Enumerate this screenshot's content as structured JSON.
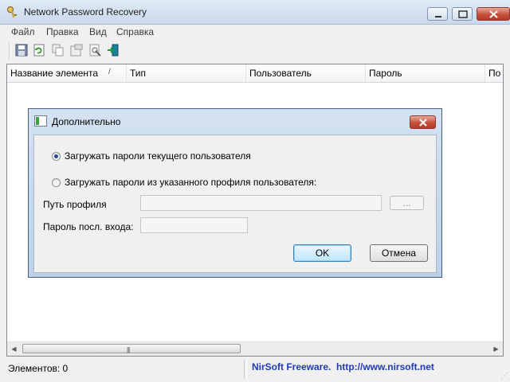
{
  "window": {
    "title": "Network Password Recovery"
  },
  "menu": {
    "items": [
      "Файл",
      "Правка",
      "Вид",
      "Справка"
    ]
  },
  "toolbar": {
    "buttons": [
      "save-icon",
      "refresh-icon",
      "copy-icon",
      "properties-icon",
      "report-icon",
      "exit-icon"
    ]
  },
  "list": {
    "columns": [
      "Название элемента",
      "Тип",
      "Пользователь",
      "Пароль",
      "По"
    ]
  },
  "status": {
    "items_label": "Элементов: 0",
    "credit": "NirSoft Freeware.  http://www.nirsoft.net"
  },
  "dialog": {
    "title": "Дополнительно",
    "radio_current": "Загружать пароли текущего пользователя",
    "radio_profile": "Загружать пароли из указанного профиля пользователя:",
    "profile_path_label": "Путь профиля",
    "last_password_label": "Пароль посл. входа:",
    "browse_label": "...",
    "ok_label": "OK",
    "cancel_label": "Отмена"
  },
  "colors": {
    "link": "#1f3ab7",
    "accent": "#3c7fb1"
  }
}
